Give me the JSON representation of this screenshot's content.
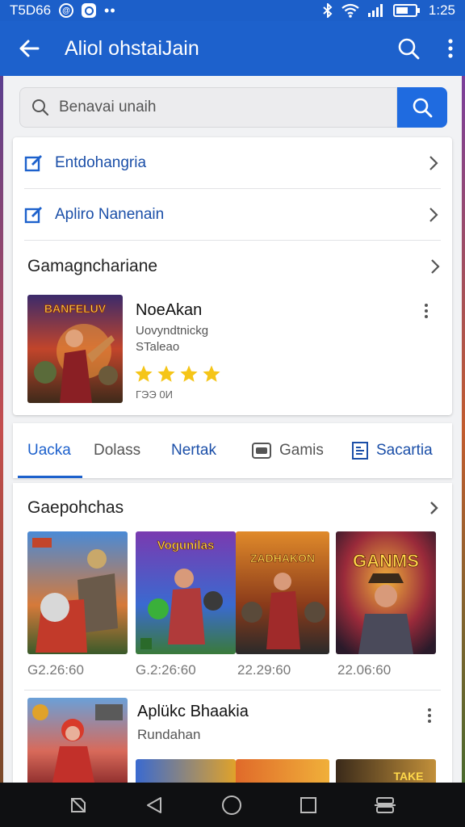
{
  "status_bar": {
    "left_text": "T5D66",
    "time": "1:25"
  },
  "app_bar": {
    "title": "Aliol ohstaiJain"
  },
  "search": {
    "placeholder": "Benavai unaih"
  },
  "menu_rows": [
    {
      "label": "Entdohangria"
    },
    {
      "label": "Apliro Nanenain"
    }
  ],
  "section": {
    "title": "Gamagnchariane"
  },
  "featured": {
    "cover_text": "BANFELUV",
    "name": "NoeAkan",
    "line1": "Uovyndtnickg",
    "line2": "STaleao",
    "rating_stars": 4,
    "meta": "ГЭЭ 0И"
  },
  "tabs": [
    {
      "label": "Uacka",
      "active": true
    },
    {
      "label": "Dolass",
      "active": false
    },
    {
      "label": "Nertak",
      "active": false
    },
    {
      "label": "Gamis",
      "active": false
    },
    {
      "label": "Sacartia",
      "active": false
    }
  ],
  "grid": {
    "title": "Gaepohchas",
    "items": [
      {
        "cover_text": "",
        "price": "G2.26:60"
      },
      {
        "cover_text": "Vogunilas",
        "price": "G.2:26:60"
      },
      {
        "cover_text": "ZADHAKON",
        "price": "22.29:60"
      },
      {
        "cover_text": "GANMS",
        "price": "22.06:60"
      }
    ]
  },
  "promo": {
    "name": "Aplükc Bhaakia",
    "sub": "Rundahan",
    "mini_text": "TAKE"
  },
  "colors": {
    "primary": "#1d61cc",
    "search_button": "#1f6be0",
    "star": "#f5c518"
  }
}
